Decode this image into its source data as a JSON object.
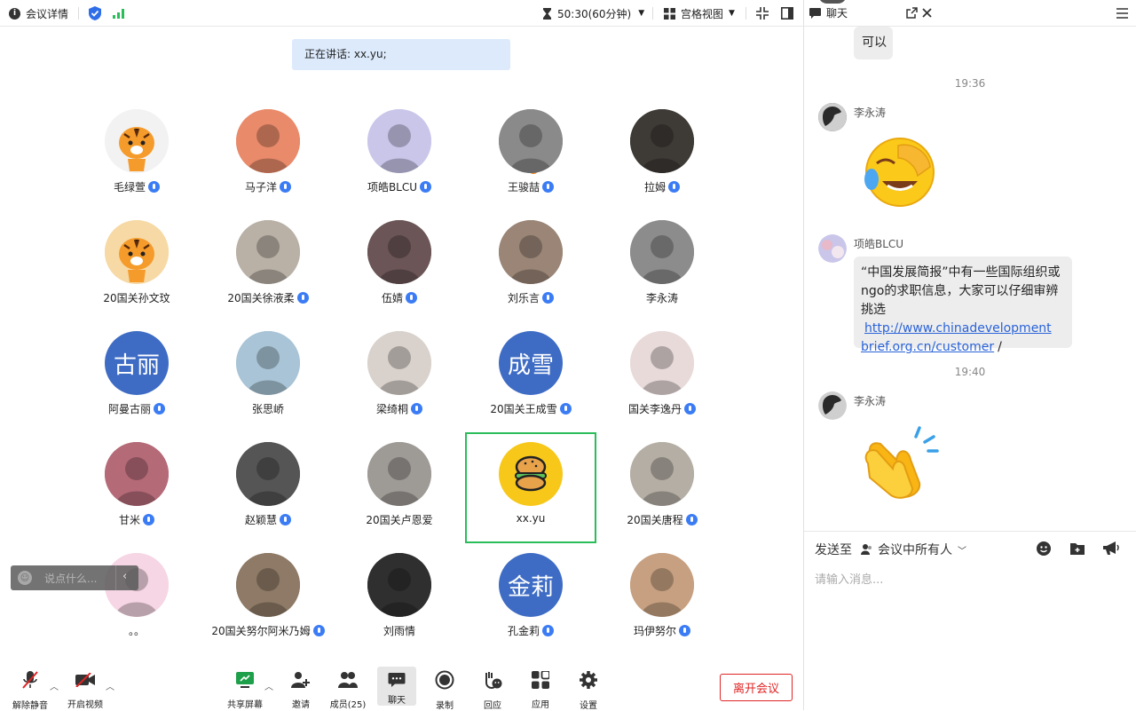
{
  "topbar": {
    "meeting_info": "会议详情",
    "timer": "50:30(60分钟)",
    "view_mode": "宫格视图"
  },
  "speaking": "正在讲话: xx.yu;",
  "participants": [
    {
      "name": "毛绿萱",
      "mic": true,
      "avatar": "tiger-cartoon",
      "color": "#f2f2f2"
    },
    {
      "name": "马子洋",
      "mic": true,
      "avatar": "photo",
      "color": "#e98a6a"
    },
    {
      "name": "项皓BLCU",
      "mic": true,
      "avatar": "photo",
      "color": "#c9c6ea"
    },
    {
      "name": "王骏喆",
      "mic": true,
      "avatar": "photo",
      "color": "#8a8a8a",
      "host": true
    },
    {
      "name": "拉姆",
      "mic": true,
      "avatar": "photo",
      "color": "#3e3a36"
    },
    {
      "name": "20国关孙文玟",
      "mic": false,
      "avatar": "tiger-cartoon",
      "color": "#f6d9a5"
    },
    {
      "name": "20国关徐液柔",
      "mic": true,
      "avatar": "photo",
      "color": "#b9b1a6"
    },
    {
      "name": "伍婧",
      "mic": true,
      "avatar": "photo",
      "color": "#6b5556"
    },
    {
      "name": "刘乐言",
      "mic": true,
      "avatar": "photo",
      "color": "#9a8576"
    },
    {
      "name": "李永涛",
      "mic": false,
      "avatar": "photo",
      "color": "#8c8c8c"
    },
    {
      "name": "阿曼古丽",
      "mic": true,
      "avatar": "text",
      "text": "古丽",
      "color": "#3e6cc4"
    },
    {
      "name": "张思峤",
      "mic": false,
      "avatar": "photo",
      "color": "#a9c4d6"
    },
    {
      "name": "梁绮桐",
      "mic": true,
      "avatar": "photo",
      "color": "#d9d2cc"
    },
    {
      "name": "20国关王成雪",
      "mic": true,
      "avatar": "text",
      "text": "成雪",
      "color": "#3e6cc4"
    },
    {
      "name": "国关李逸丹",
      "mic": true,
      "avatar": "photo",
      "color": "#e9dada"
    },
    {
      "name": "甘米",
      "mic": true,
      "avatar": "photo",
      "color": "#b56a78"
    },
    {
      "name": "赵颖慧",
      "mic": true,
      "avatar": "photo",
      "color": "#555555"
    },
    {
      "name": "20国关卢恩爱",
      "mic": false,
      "avatar": "photo",
      "color": "#9e9a96"
    },
    {
      "name": "xx.yu",
      "mic": false,
      "avatar": "burger",
      "color": "#f7c81a",
      "active": true
    },
    {
      "name": "20国关唐程",
      "mic": true,
      "avatar": "photo",
      "color": "#b5aea4"
    },
    {
      "name": "。。",
      "mic": false,
      "avatar": "photo",
      "color": "#f6d6e4"
    },
    {
      "name": "20国关努尔阿米乃姆",
      "mic": true,
      "avatar": "photo",
      "color": "#8e7a66"
    },
    {
      "name": "刘雨情",
      "mic": false,
      "avatar": "photo",
      "color": "#2f2f2f"
    },
    {
      "name": "孔金莉",
      "mic": true,
      "avatar": "text",
      "text": "金莉",
      "color": "#3e6cc4"
    },
    {
      "name": "玛伊努尔",
      "mic": true,
      "avatar": "photo",
      "color": "#c6a080"
    }
  ],
  "floating_chat": {
    "placeholder": "说点什么..."
  },
  "toolbar": {
    "unmute": "解除静音",
    "start_video": "开启视频",
    "share_screen": "共享屏幕",
    "invite": "邀请",
    "members": "成员(25)",
    "chat": "聊天",
    "record": "录制",
    "react": "回应",
    "apps": "应用",
    "settings": "设置",
    "leave": "离开会议"
  },
  "chat": {
    "title": "聊天",
    "prev_bubble": "可以",
    "time1": "19:36",
    "sender1": "李永涛",
    "time2": "19:40",
    "sender2": "项皓BLCU",
    "msg_part1": "“中国发展简报”中有一些国际组织或",
    "msg_part2": "ngo的求职信息，大家可以仔细审辨",
    "msg_part3": "挑选",
    "msg_link1": "http://www.chinadevelopment",
    "msg_link2": "brief.org.cn/customer",
    "msg_tail": "/",
    "sender3": "李永涛",
    "send_to_label": "发送至",
    "send_to_target": "会议中所有人",
    "input_placeholder": "请输入消息..."
  }
}
